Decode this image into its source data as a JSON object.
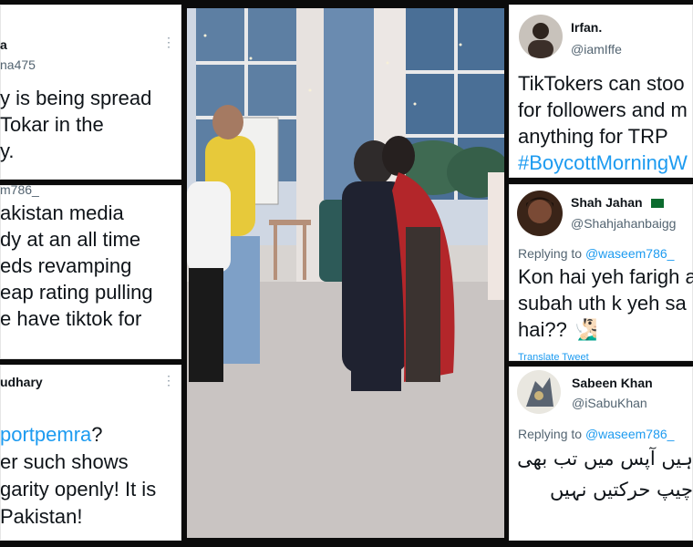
{
  "tweets": {
    "t1": {
      "name": "a",
      "handle": "na475",
      "lines": [
        "y is being spread",
        "Tokar in the",
        "y."
      ]
    },
    "t2": {
      "handle_partial": "m786_",
      "lines": [
        "akistan media",
        "dy at an all time",
        "eds revamping",
        "eap rating pulling",
        "e have tiktok for"
      ]
    },
    "t3": {
      "name": "udhary",
      "hashtag": "portpemra",
      "lines_after_hashtag": "?",
      "lines": [
        "er such shows",
        "garity openly! It is",
        "Pakistan!"
      ]
    },
    "t4": {
      "name": "Irfan.",
      "handle": "@iamIffe",
      "lines": [
        "TikTokers can stoo",
        "for followers and m",
        "anything for TRP"
      ],
      "hashtag": "#BoycottMorningW"
    },
    "t5": {
      "name": "Shah Jahan",
      "handle": "@Shahjahanbaigg",
      "reply_prefix": "Replying to ",
      "reply_handle": "@waseem786_",
      "lines": [
        "Kon hai yeh farigh a",
        "subah uth k yeh sa",
        "hai?? 🧏🏻‍♂️"
      ],
      "translate": "Translate Tweet"
    },
    "t6": {
      "name": "Sabeen Khan",
      "handle": "@iSabuKhan",
      "reply_prefix": "Replying to ",
      "reply_handle": "@waseem786_",
      "urdu_lines": [
        "ہیں آپس میں تب بھی",
        "چیپ حرکتیں نہیں"
      ]
    }
  },
  "colors": {
    "link": "#1d9bf0",
    "text": "#0f1419",
    "muted": "#536471",
    "background": "#0b0b0b"
  },
  "icons": [
    "more-dots-icon",
    "pakistan-flag-icon",
    "person-gesturing-emoji"
  ]
}
